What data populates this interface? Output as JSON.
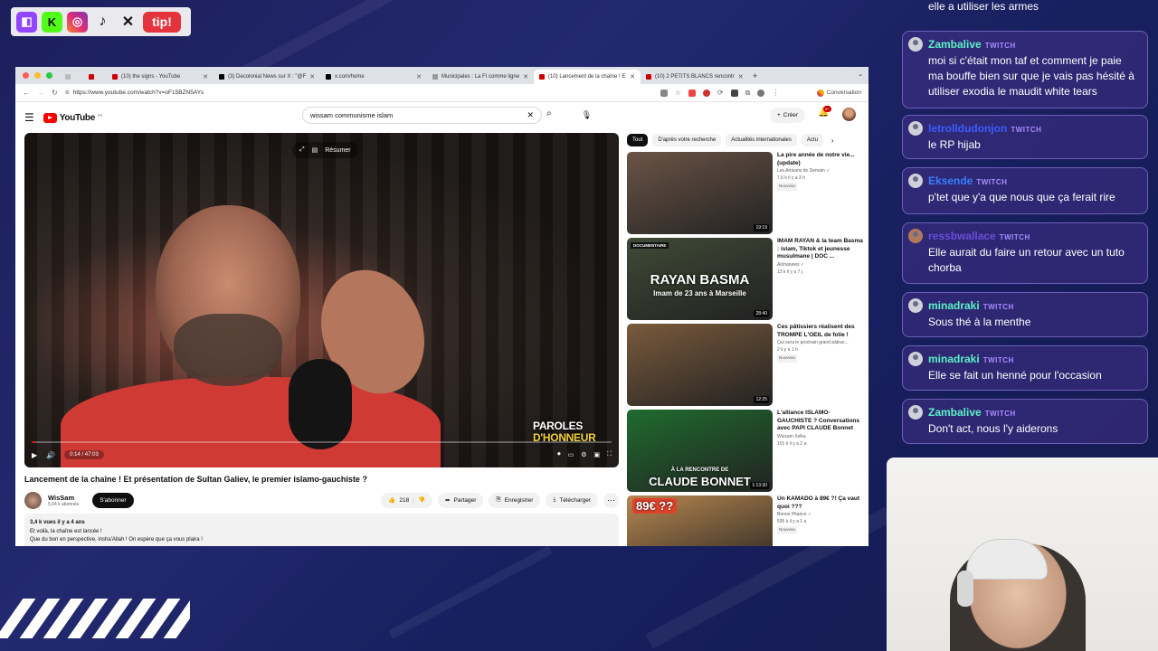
{
  "social": {
    "tip_label": "tip!"
  },
  "browser": {
    "tabs": [
      {
        "label": ""
      },
      {
        "label": "(10) the signs - YouTube"
      },
      {
        "label": "(3) Decolonial News sur X : \"@F"
      },
      {
        "label": "x.com/home"
      },
      {
        "label": "Municipales : La FI comme ligne"
      },
      {
        "label": "(10) Lancement de la chaîne ! E"
      },
      {
        "label": "(10) 2 PETITS BLANCS rencontr"
      }
    ],
    "url": "https://www.youtube.com/watch?v=oF15BZN5AYs",
    "conversation_label": "Conversation"
  },
  "youtube": {
    "logo_text": "YouTube",
    "region": "FR",
    "search_value": "wissam communisme islam",
    "create_label": "Créer",
    "bell_badge": "9+",
    "player": {
      "resume_label": "Résumer",
      "time": "0:14 / 47:03",
      "progress": 0.005,
      "overlay_line1": "PAROLES",
      "overlay_line2": "D'HONNEUR"
    },
    "video_title": "Lancement de la chaîne ! Et présentation de Sultan Galiev, le premier islamo-gauchiste ?",
    "channel": {
      "name": "WisSam",
      "subs": "5,04 k abonnés",
      "subscribe_label": "S'abonner"
    },
    "actions": {
      "likes": "218",
      "share": "Partager",
      "save": "Enregistrer",
      "download": "Télécharger"
    },
    "description": {
      "stats": "3,4 k vues  il y a 4 ans",
      "line1": "Et voilà, la chaîne est lancée !",
      "line2": "Que du bon en perspective, insha'Allah ! On espère que ça vous plaira !"
    },
    "chips": [
      "Tout",
      "D'après votre recherche",
      "Actualités internationales",
      "Actu"
    ],
    "recommended": [
      {
        "title": "La pire année de notre vie... (update)",
        "channel": "Les Artisans de Demain ✓",
        "stats": "7,6 k  il y a 3 h",
        "badge": "Nouveau",
        "duration": "19:19",
        "thumb_tag": "",
        "thumb_text": "",
        "thumb_color": "#6b5446"
      },
      {
        "title": "IMAM RAYAN & la team Basma : islam, Tiktok et jeunesse musulmane | DOC ...",
        "channel": "Alohanews ✓",
        "stats": "13 k  il y a 7 j",
        "badge": "",
        "duration": "28:40",
        "thumb_tag": "DOCUMENTAIRE",
        "thumb_text": "RAYAN BASMA",
        "thumb_sub": "Imam de 23 ans à Marseille",
        "thumb_color": "#3f4a36"
      },
      {
        "title": "Ces pâtissiers réalisent des TROMPE L'OEIL de folie !",
        "channel": "Qui sera le prochain grand pâtissi...",
        "stats": "2  il y a 1 h",
        "badge": "Nouveau",
        "duration": "12:25",
        "thumb_tag": "",
        "thumb_text": "",
        "thumb_color": "#7a5a3c"
      },
      {
        "title": "L'alliance ISLAMO-GAUCHISTE ? Conversations avec PAPI CLAUDE Bonnet",
        "channel": "Wissam Xelka",
        "stats": "101 k  il y a 2 a",
        "badge": "",
        "duration": "1:13:30",
        "thumb_tag": "",
        "thumb_text": "CLAUDE BONNET",
        "thumb_sub": "À LA RENCONTRE DE",
        "thumb_color": "#1f6b2e"
      },
      {
        "title": "Un KAMADO à 89€ ?! Ça vaut quoi ???",
        "channel": "Bonne Pitance ✓",
        "stats": "595 k  il y a 1 a",
        "badge": "Nouveau",
        "duration": "",
        "thumb_tag": "",
        "thumb_text": "89€ ??",
        "thumb_color": "#b8874f"
      }
    ]
  },
  "chat": {
    "top_partial": "elle a utiliser les armes",
    "platform_label": "TWITCH",
    "messages": [
      {
        "user": "Zambalive",
        "user_color": "#5df2c6",
        "text": "moi si c'était mon taf et comment je paie ma bouffe bien sur que je vais pas hésité à utiliser exodia le maudit white tears"
      },
      {
        "user": "letrolldudonjon",
        "user_color": "#3c5bff",
        "text": "le RP hijab"
      },
      {
        "user": "Eksende",
        "user_color": "#3a7dff",
        "text": "p'tet que y'a que nous que ça ferait rire"
      },
      {
        "user": "ressbwallace",
        "user_color": "#6a4dd8",
        "text": "Elle aurait du faire un retour avec un tuto chorba"
      },
      {
        "user": "minadraki",
        "user_color": "#5df2c6",
        "text": "Sous thé à la menthe"
      },
      {
        "user": "minadraki",
        "user_color": "#5df2c6",
        "text": "Elle se fait un henné pour l'occasion"
      },
      {
        "user": "Zambalive",
        "user_color": "#5df2c6",
        "text": "Don't act, nous l'y aiderons"
      }
    ]
  }
}
